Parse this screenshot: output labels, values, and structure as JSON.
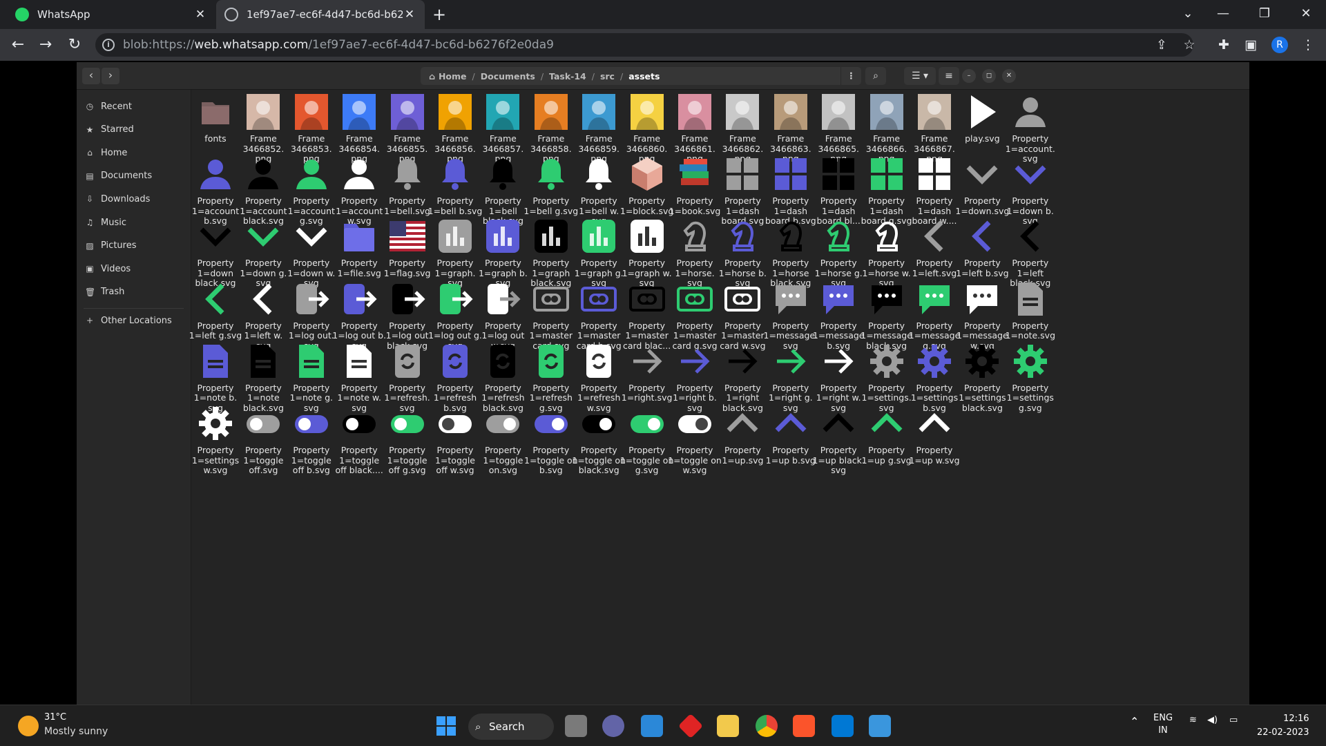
{
  "browser": {
    "tabs": [
      {
        "title": "WhatsApp",
        "favicon": "whatsapp-icon"
      },
      {
        "title": "1ef97ae7-ec6f-4d47-bc6d-b6276",
        "favicon": "globe-icon"
      }
    ],
    "address": {
      "prefix": "blob:https://",
      "domain": "web.whatsapp.com",
      "path": "/1ef97ae7-ec6f-4d47-bc6d-b6276f2e0da9"
    },
    "profile_initial": "R"
  },
  "file_manager": {
    "path": [
      "Home",
      "Documents",
      "Task-14",
      "src",
      "assets"
    ],
    "sidebar": [
      {
        "label": "Recent",
        "icon": "clock-icon"
      },
      {
        "label": "Starred",
        "icon": "star-icon"
      },
      {
        "label": "Home",
        "icon": "home-icon"
      },
      {
        "label": "Documents",
        "icon": "document-icon"
      },
      {
        "label": "Downloads",
        "icon": "download-icon"
      },
      {
        "label": "Music",
        "icon": "music-icon"
      },
      {
        "label": "Pictures",
        "icon": "picture-icon"
      },
      {
        "label": "Videos",
        "icon": "video-icon"
      },
      {
        "label": "Trash",
        "icon": "trash-icon"
      },
      {
        "label": "Other Locations",
        "icon": "plus-icon"
      }
    ],
    "files": [
      {
        "label": "fonts",
        "icon": "folder"
      },
      {
        "label": "Frame\n3466852.\npng",
        "icon": "photo"
      },
      {
        "label": "Frame\n3466853.\npng",
        "icon": "photo"
      },
      {
        "label": "Frame\n3466854.\npng",
        "icon": "photo"
      },
      {
        "label": "Frame\n3466855.\npng",
        "icon": "photo"
      },
      {
        "label": "Frame\n3466856.\npng",
        "icon": "photo"
      },
      {
        "label": "Frame\n3466857.\npng",
        "icon": "photo"
      },
      {
        "label": "Frame\n3466858.\npng",
        "icon": "photo"
      },
      {
        "label": "Frame\n3466859.\npng",
        "icon": "photo"
      },
      {
        "label": "Frame\n3466860.\npng",
        "icon": "photo"
      },
      {
        "label": "Frame\n3466861.\npng",
        "icon": "photo"
      },
      {
        "label": "Frame\n3466862.\npng",
        "icon": "photo"
      },
      {
        "label": "Frame\n3466863.\npng",
        "icon": "photo"
      },
      {
        "label": "Frame\n3466865.\npng",
        "icon": "photo"
      },
      {
        "label": "Frame\n3466866.\npng",
        "icon": "photo"
      },
      {
        "label": "Frame\n3466867.\npng",
        "icon": "photo"
      },
      {
        "label": "play.svg",
        "icon": "play",
        "color": "#ffffff"
      },
      {
        "label": "Property\n1=account.\nsvg",
        "icon": "account",
        "color": "#9e9e9e"
      },
      {
        "label": "Property\n1=account\nb.svg",
        "icon": "account",
        "color": "#5b5bd6"
      },
      {
        "label": "Property\n1=account\nblack.svg",
        "icon": "account",
        "color": "#000000"
      },
      {
        "label": "Property\n1=account\ng.svg",
        "icon": "account",
        "color": "#2ecc71"
      },
      {
        "label": "Property\n1=account\nw.svg",
        "icon": "account",
        "color": "#ffffff"
      },
      {
        "label": "Property\n1=bell.svg",
        "icon": "bell",
        "color": "#9e9e9e"
      },
      {
        "label": "Property\n1=bell b.svg",
        "icon": "bell",
        "color": "#5b5bd6"
      },
      {
        "label": "Property\n1=bell\nblack.svg",
        "icon": "bell",
        "color": "#000000"
      },
      {
        "label": "Property\n1=bell g.svg",
        "icon": "bell",
        "color": "#2ecc71"
      },
      {
        "label": "Property\n1=bell w.\nsvg",
        "icon": "bell",
        "color": "#ffffff"
      },
      {
        "label": "Property\n1=block.svg",
        "icon": "block",
        "color": "#e8b4a0"
      },
      {
        "label": "Property\n1=book.svg",
        "icon": "book",
        "color": "#c0392b"
      },
      {
        "label": "Property\n1=dash\nboard.svg",
        "icon": "dashboard",
        "color": "#9e9e9e"
      },
      {
        "label": "Property\n1=dash\nboard b.svg",
        "icon": "dashboard",
        "color": "#5b5bd6"
      },
      {
        "label": "Property\n1=dash\nboard bl...",
        "icon": "dashboard",
        "color": "#000000"
      },
      {
        "label": "Property\n1=dash\nboard g.svg",
        "icon": "dashboard",
        "color": "#2ecc71"
      },
      {
        "label": "Property\n1=dash\nboard w....",
        "icon": "dashboard",
        "color": "#ffffff"
      },
      {
        "label": "Property\n1=down.svg",
        "icon": "down",
        "color": "#9e9e9e"
      },
      {
        "label": "Property\n1=down b.\nsvg",
        "icon": "down",
        "color": "#5b5bd6"
      },
      {
        "label": "Property\n1=down\nblack.svg",
        "icon": "down",
        "color": "#000000"
      },
      {
        "label": "Property\n1=down g.\nsvg",
        "icon": "down",
        "color": "#2ecc71"
      },
      {
        "label": "Property\n1=down w.\nsvg",
        "icon": "down",
        "color": "#ffffff"
      },
      {
        "label": "Property\n1=file.svg",
        "icon": "file",
        "color": "#5b5bd6"
      },
      {
        "label": "Property\n1=flag.svg",
        "icon": "flag",
        "color": "#b22234"
      },
      {
        "label": "Property\n1=graph.\nsvg",
        "icon": "graph",
        "color": "#9e9e9e"
      },
      {
        "label": "Property\n1=graph b.\nsvg",
        "icon": "graph",
        "color": "#5b5bd6"
      },
      {
        "label": "Property\n1=graph\nblack.svg",
        "icon": "graph",
        "color": "#000000"
      },
      {
        "label": "Property\n1=graph g.\nsvg",
        "icon": "graph",
        "color": "#2ecc71"
      },
      {
        "label": "Property\n1=graph w.\nsvg",
        "icon": "graph",
        "color": "#ffffff"
      },
      {
        "label": "Property\n1=horse.\nsvg",
        "icon": "horse",
        "color": "#9e9e9e"
      },
      {
        "label": "Property\n1=horse b.\nsvg",
        "icon": "horse",
        "color": "#5b5bd6"
      },
      {
        "label": "Property\n1=horse\nblack.svg",
        "icon": "horse",
        "color": "#000000"
      },
      {
        "label": "Property\n1=horse g.\nsvg",
        "icon": "horse",
        "color": "#2ecc71"
      },
      {
        "label": "Property\n1=horse w.\nsvg",
        "icon": "horse",
        "color": "#ffffff"
      },
      {
        "label": "Property\n1=left.svg",
        "icon": "left",
        "color": "#9e9e9e"
      },
      {
        "label": "Property\n1=left b.svg",
        "icon": "left",
        "color": "#5b5bd6"
      },
      {
        "label": "Property\n1=left\nblack.svg",
        "icon": "left",
        "color": "#000000"
      },
      {
        "label": "Property\n1=left g.svg",
        "icon": "left",
        "color": "#2ecc71"
      },
      {
        "label": "Property\n1=left w.\nsvg",
        "icon": "left",
        "color": "#ffffff"
      },
      {
        "label": "Property\n1=log out.\nsvg",
        "icon": "logout",
        "color": "#9e9e9e"
      },
      {
        "label": "Property\n1=log out b.\nsvg",
        "icon": "logout",
        "color": "#5b5bd6"
      },
      {
        "label": "Property\n1=log out\nblack.svg",
        "icon": "logout",
        "color": "#000000"
      },
      {
        "label": "Property\n1=log out g.\nsvg",
        "icon": "logout",
        "color": "#2ecc71"
      },
      {
        "label": "Property\n1=log out\nw.svg",
        "icon": "logout",
        "color": "#ffffff"
      },
      {
        "label": "Property\n1=master\ncard.svg",
        "icon": "card",
        "color": "#9e9e9e"
      },
      {
        "label": "Property\n1=master\ncard b.svg",
        "icon": "card",
        "color": "#5b5bd6"
      },
      {
        "label": "Property\n1=master\ncard blac...",
        "icon": "card",
        "color": "#000000"
      },
      {
        "label": "Property\n1=master\ncard g.svg",
        "icon": "card",
        "color": "#2ecc71"
      },
      {
        "label": "Property\n1=master\ncard w.svg",
        "icon": "card",
        "color": "#ffffff"
      },
      {
        "label": "Property\n1=message.\nsvg",
        "icon": "message",
        "color": "#9e9e9e"
      },
      {
        "label": "Property\n1=message\nb.svg",
        "icon": "message",
        "color": "#5b5bd6"
      },
      {
        "label": "Property\n1=message\nblack.svg",
        "icon": "message",
        "color": "#000000"
      },
      {
        "label": "Property\n1=message\ng.svg",
        "icon": "message",
        "color": "#2ecc71"
      },
      {
        "label": "Property\n1=message\nw.svg",
        "icon": "message",
        "color": "#ffffff"
      },
      {
        "label": "Property\n1=note.svg",
        "icon": "note",
        "color": "#9e9e9e"
      },
      {
        "label": "Property\n1=note b.\nsvg",
        "icon": "note",
        "color": "#5b5bd6"
      },
      {
        "label": "Property\n1=note\nblack.svg",
        "icon": "note",
        "color": "#000000"
      },
      {
        "label": "Property\n1=note g.\nsvg",
        "icon": "note",
        "color": "#2ecc71"
      },
      {
        "label": "Property\n1=note w.\nsvg",
        "icon": "note",
        "color": "#ffffff"
      },
      {
        "label": "Property\n1=refresh.\nsvg",
        "icon": "refresh",
        "color": "#9e9e9e"
      },
      {
        "label": "Property\n1=refresh\nb.svg",
        "icon": "refresh",
        "color": "#5b5bd6"
      },
      {
        "label": "Property\n1=refresh\nblack.svg",
        "icon": "refresh",
        "color": "#000000"
      },
      {
        "label": "Property\n1=refresh\ng.svg",
        "icon": "refresh",
        "color": "#2ecc71"
      },
      {
        "label": "Property\n1=refresh\nw.svg",
        "icon": "refresh",
        "color": "#ffffff"
      },
      {
        "label": "Property\n1=right.svg",
        "icon": "right",
        "color": "#9e9e9e"
      },
      {
        "label": "Property\n1=right b.\nsvg",
        "icon": "right",
        "color": "#5b5bd6"
      },
      {
        "label": "Property\n1=right\nblack.svg",
        "icon": "right",
        "color": "#000000"
      },
      {
        "label": "Property\n1=right g.\nsvg",
        "icon": "right",
        "color": "#2ecc71"
      },
      {
        "label": "Property\n1=right w.\nsvg",
        "icon": "right",
        "color": "#ffffff"
      },
      {
        "label": "Property\n1=settings.\nsvg",
        "icon": "settings",
        "color": "#9e9e9e"
      },
      {
        "label": "Property\n1=settings\nb.svg",
        "icon": "settings",
        "color": "#5b5bd6"
      },
      {
        "label": "Property\n1=settings\nblack.svg",
        "icon": "settings",
        "color": "#000000"
      },
      {
        "label": "Property\n1=settings\ng.svg",
        "icon": "settings",
        "color": "#2ecc71"
      },
      {
        "label": "Property\n1=settings\nw.svg",
        "icon": "settings",
        "color": "#ffffff"
      },
      {
        "label": "Property\n1=toggle\noff.svg",
        "icon": "toggle-off",
        "color": "#9e9e9e"
      },
      {
        "label": "Property\n1=toggle\noff b.svg",
        "icon": "toggle-off",
        "color": "#5b5bd6"
      },
      {
        "label": "Property\n1=toggle\noff black....",
        "icon": "toggle-off",
        "color": "#000000"
      },
      {
        "label": "Property\n1=toggle\noff g.svg",
        "icon": "toggle-off",
        "color": "#2ecc71"
      },
      {
        "label": "Property\n1=toggle\noff w.svg",
        "icon": "toggle-off",
        "color": "#ffffff"
      },
      {
        "label": "Property\n1=toggle\non.svg",
        "icon": "toggle-on",
        "color": "#9e9e9e"
      },
      {
        "label": "Property\n1=toggle on\nb.svg",
        "icon": "toggle-on",
        "color": "#5b5bd6"
      },
      {
        "label": "Property\n1=toggle on\nblack.svg",
        "icon": "toggle-on",
        "color": "#000000"
      },
      {
        "label": "Property\n1=toggle on\ng.svg",
        "icon": "toggle-on",
        "color": "#2ecc71"
      },
      {
        "label": "Property\n1=toggle on\nw.svg",
        "icon": "toggle-on",
        "color": "#ffffff"
      },
      {
        "label": "Property\n1=up.svg",
        "icon": "up",
        "color": "#9e9e9e"
      },
      {
        "label": "Property\n1=up b.svg",
        "icon": "up",
        "color": "#5b5bd6"
      },
      {
        "label": "Property\n1=up black.\nsvg",
        "icon": "up",
        "color": "#000000"
      },
      {
        "label": "Property\n1=up g.svg",
        "icon": "up",
        "color": "#2ecc71"
      },
      {
        "label": "Property\n1=up w.svg",
        "icon": "up",
        "color": "#ffffff"
      }
    ]
  },
  "taskbar": {
    "temperature": "31°C",
    "weather": "Mostly sunny",
    "search_label": "Search",
    "lang": "ENG",
    "region": "IN",
    "time": "12:16",
    "date": "22-02-2023"
  }
}
